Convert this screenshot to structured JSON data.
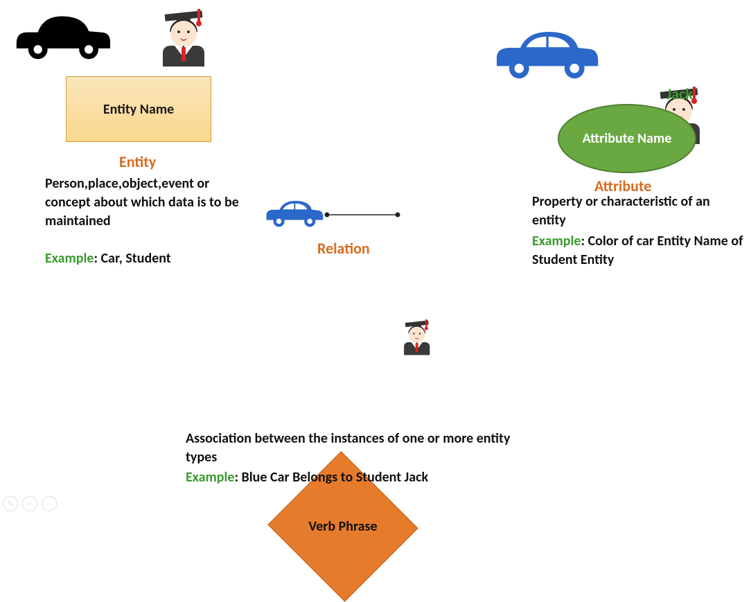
{
  "entity": {
    "shape_label": "Entity Name",
    "heading": "Entity",
    "description": "Person,place,object,event or concept about which data is to be maintained",
    "example_label": "Example",
    "example_text": ": Car, Student"
  },
  "attribute": {
    "jack_label": "Jack",
    "shape_label": "Attribute Name",
    "heading": "Attribute",
    "description": "Property or characteristic of an entity",
    "example_label": "Example",
    "example_text": ": Color of car Entity Name of Student Entity"
  },
  "relation": {
    "heading": "Relation",
    "shape_label": "Verb Phrase",
    "description": "Association between the instances of one or more entity types",
    "example_label": "Example",
    "example_text": ": Blue Car Belongs to Student Jack"
  },
  "icons": {
    "car_black": "car-icon",
    "car_blue": "car-icon",
    "student": "student-graduate-icon"
  }
}
